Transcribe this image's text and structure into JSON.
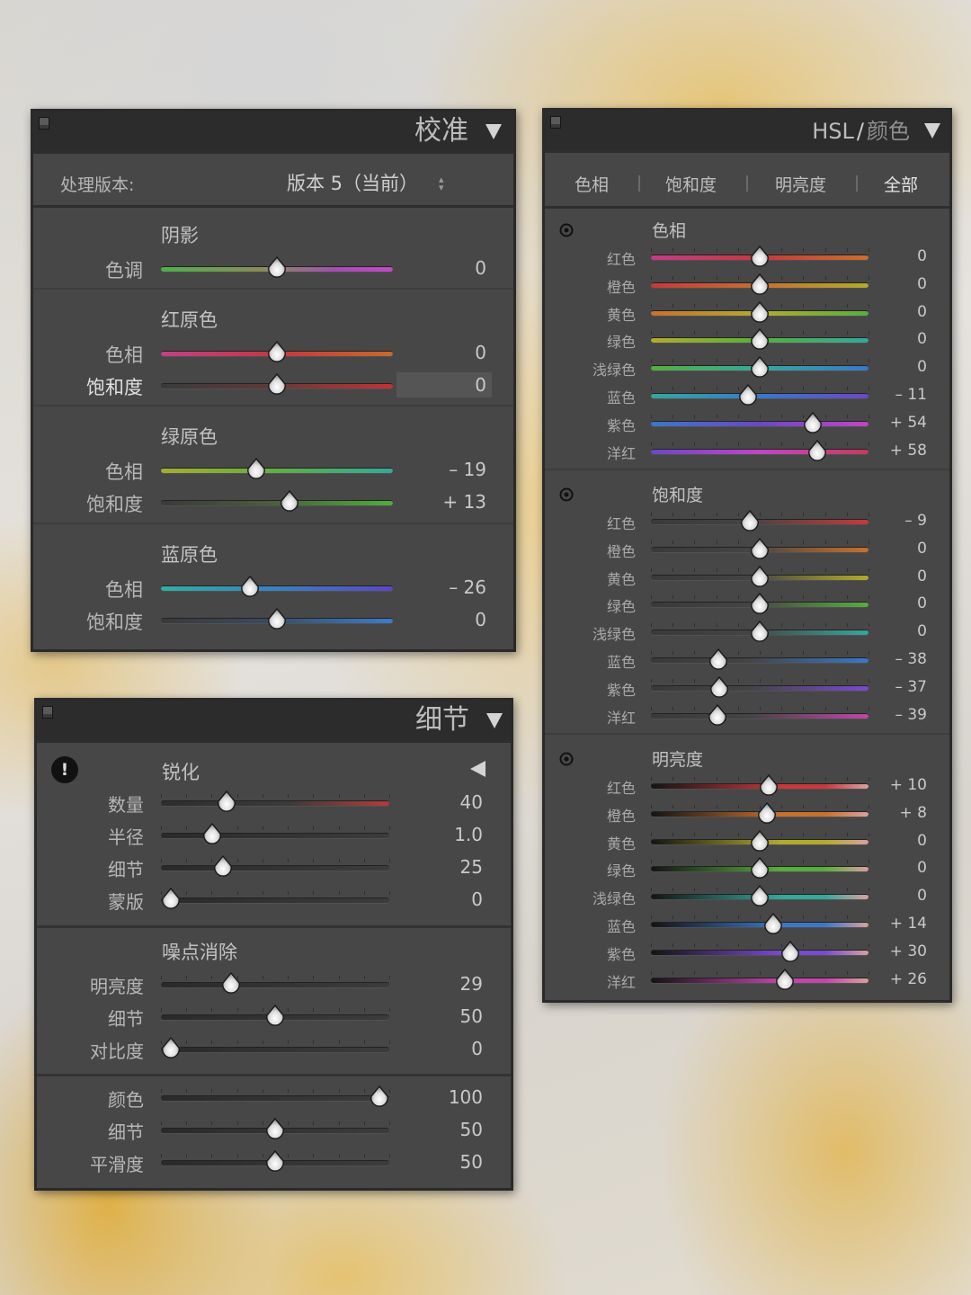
{
  "calibration": {
    "title": "校准",
    "process_label": "处理版本:",
    "process_value": "版本 5（当前）",
    "sections": [
      {
        "title": "阴影",
        "sliders": [
          {
            "label": "色调",
            "value": "0",
            "fraction": 0.5,
            "track": "green-magenta"
          }
        ]
      },
      {
        "title": "红原色",
        "sliders": [
          {
            "label": "色相",
            "value": "0",
            "fraction": 0.5,
            "track": "red-hue"
          },
          {
            "label": "饱和度",
            "value": "0",
            "fraction": 0.5,
            "track": "red-sat",
            "active": true
          }
        ]
      },
      {
        "title": "绿原色",
        "sliders": [
          {
            "label": "色相",
            "value": "– 19",
            "fraction": 0.41,
            "track": "green-hue"
          },
          {
            "label": "饱和度",
            "value": "+ 13",
            "fraction": 0.555,
            "track": "green-sat"
          }
        ]
      },
      {
        "title": "蓝原色",
        "sliders": [
          {
            "label": "色相",
            "value": "– 26",
            "fraction": 0.385,
            "track": "blue-hue"
          },
          {
            "label": "饱和度",
            "value": "0",
            "fraction": 0.5,
            "track": "blue-sat"
          }
        ]
      }
    ]
  },
  "detail": {
    "title": "细节",
    "sharpen": {
      "title": "锐化",
      "sliders": [
        {
          "label": "数量",
          "value": "40",
          "fraction": 0.267,
          "track": "amount"
        },
        {
          "label": "半径",
          "value": "1.0",
          "fraction": 0.2,
          "track": "gray"
        },
        {
          "label": "细节",
          "value": "25",
          "fraction": 0.25,
          "track": "gray"
        },
        {
          "label": "蒙版",
          "value": "0",
          "fraction": 0.0,
          "track": "gray"
        }
      ]
    },
    "noise": {
      "title": "噪点消除",
      "sliders": [
        {
          "label": "明亮度",
          "value": "29",
          "fraction": 0.29,
          "track": "gray"
        },
        {
          "label": "细节",
          "value": "50",
          "fraction": 0.5,
          "track": "gray"
        },
        {
          "label": "对比度",
          "value": "0",
          "fraction": 0.0,
          "track": "gray"
        }
      ]
    },
    "color": {
      "sliders": [
        {
          "label": "颜色",
          "value": "100",
          "fraction": 1.0,
          "track": "gray"
        },
        {
          "label": "细节",
          "value": "50",
          "fraction": 0.5,
          "track": "gray"
        },
        {
          "label": "平滑度",
          "value": "50",
          "fraction": 0.5,
          "track": "gray"
        }
      ]
    }
  },
  "hsl": {
    "title_a": "HSL",
    "title_slash": "/",
    "title_b": "颜色",
    "tabs": [
      "色相",
      "饱和度",
      "明亮度",
      "全部"
    ],
    "active_tab": "全部",
    "sections": [
      {
        "key": "hue",
        "title": "色相",
        "sliders": [
          {
            "label": "红色",
            "value": "0",
            "fraction": 0.5
          },
          {
            "label": "橙色",
            "value": "0",
            "fraction": 0.5
          },
          {
            "label": "黄色",
            "value": "0",
            "fraction": 0.5
          },
          {
            "label": "绿色",
            "value": "0",
            "fraction": 0.5
          },
          {
            "label": "浅绿色",
            "value": "0",
            "fraction": 0.5
          },
          {
            "label": "蓝色",
            "value": "– 11",
            "fraction": 0.445
          },
          {
            "label": "紫色",
            "value": "+ 54",
            "fraction": 0.745
          },
          {
            "label": "洋红",
            "value": "+ 58",
            "fraction": 0.765
          }
        ]
      },
      {
        "key": "sat",
        "title": "饱和度",
        "sliders": [
          {
            "label": "红色",
            "value": "– 9",
            "fraction": 0.455
          },
          {
            "label": "橙色",
            "value": "0",
            "fraction": 0.5
          },
          {
            "label": "黄色",
            "value": "0",
            "fraction": 0.5
          },
          {
            "label": "绿色",
            "value": "0",
            "fraction": 0.5
          },
          {
            "label": "浅绿色",
            "value": "0",
            "fraction": 0.5
          },
          {
            "label": "蓝色",
            "value": "– 38",
            "fraction": 0.31
          },
          {
            "label": "紫色",
            "value": "– 37",
            "fraction": 0.315
          },
          {
            "label": "洋红",
            "value": "– 39",
            "fraction": 0.305
          }
        ]
      },
      {
        "key": "lum",
        "title": "明亮度",
        "sliders": [
          {
            "label": "红色",
            "value": "+ 10",
            "fraction": 0.54
          },
          {
            "label": "橙色",
            "value": "+ 8",
            "fraction": 0.535
          },
          {
            "label": "黄色",
            "value": "0",
            "fraction": 0.5
          },
          {
            "label": "绿色",
            "value": "0",
            "fraction": 0.5
          },
          {
            "label": "浅绿色",
            "value": "0",
            "fraction": 0.5
          },
          {
            "label": "蓝色",
            "value": "+ 14",
            "fraction": 0.56
          },
          {
            "label": "紫色",
            "value": "+ 30",
            "fraction": 0.64
          },
          {
            "label": "洋红",
            "value": "+ 26",
            "fraction": 0.615
          }
        ]
      }
    ]
  },
  "colors": {
    "panel_bg": "#474747",
    "header_bg": "#2c2c2c",
    "text": "#bdbdbd",
    "value_text": "#c9c9c9",
    "active_field": "#555555"
  }
}
